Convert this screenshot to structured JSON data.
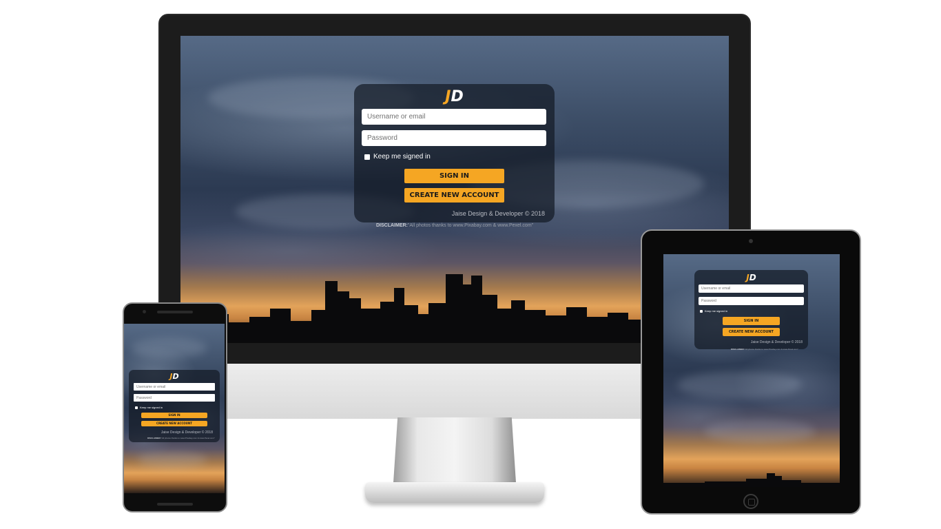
{
  "login": {
    "logo_j": "J",
    "logo_d": "D",
    "username_placeholder": "Username or email",
    "password_placeholder": "Password",
    "keep_signed_in": "Keep me signed in",
    "sign_in": "SIGN IN",
    "create_account": "CREATE NEW ACCOUNT",
    "footer": "Jaise Design & Developer © 2018",
    "disclaimer_label": "DISCLAIMER:",
    "disclaimer_text": "\"All photos thanks to www.Pixabay.com & www.Pexel.com\""
  },
  "colors": {
    "accent": "#f5a623",
    "card": "#141a26",
    "frame": "#1c1c1c"
  },
  "icons": [
    "jd-logo-icon",
    "checkbox-icon",
    "home-button-icon",
    "camera-icon",
    "speaker-icon"
  ]
}
